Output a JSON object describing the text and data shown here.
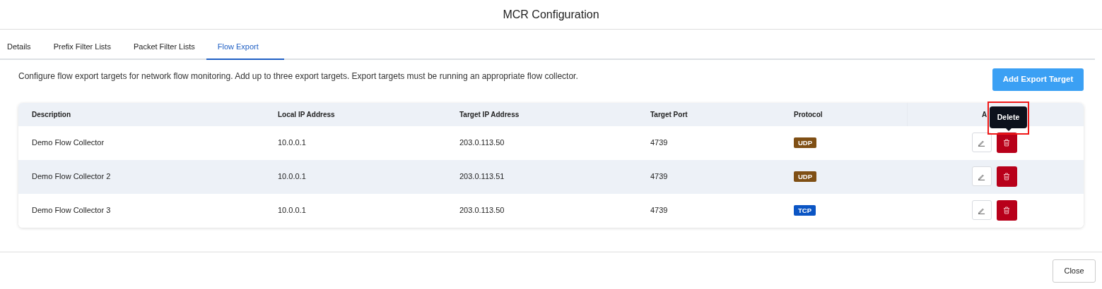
{
  "window": {
    "title": "MCR Configuration"
  },
  "tabs": [
    {
      "label": "Details",
      "selected": false
    },
    {
      "label": "Prefix Filter Lists",
      "selected": false
    },
    {
      "label": "Packet Filter Lists",
      "selected": false
    },
    {
      "label": "Flow Export",
      "selected": true
    }
  ],
  "description": "Configure flow export targets for network flow monitoring. Add up to three export targets. Export targets must be running an appropriate flow collector.",
  "add_button": "Add Export Target",
  "table": {
    "columns": [
      "Description",
      "Local IP Address",
      "Target IP Address",
      "Target Port",
      "Protocol",
      "A"
    ],
    "rows": [
      {
        "description": "Demo Flow Collector",
        "local_ip": "10.0.0.1",
        "target_ip": "203.0.113.50",
        "target_port": "4739",
        "protocol": "UDP",
        "color": "#7f4f14"
      },
      {
        "description": "Demo Flow Collector 2",
        "local_ip": "10.0.0.1",
        "target_ip": "203.0.113.51",
        "target_port": "4739",
        "protocol": "UDP",
        "color": "#7f4f14"
      },
      {
        "description": "Demo Flow Collector 3",
        "local_ip": "10.0.0.1",
        "target_ip": "203.0.113.50",
        "target_port": "4739",
        "protocol": "TCP",
        "color": "#0b55c4"
      }
    ]
  },
  "tooltip": {
    "text": "Delete"
  },
  "close_button": "Close"
}
